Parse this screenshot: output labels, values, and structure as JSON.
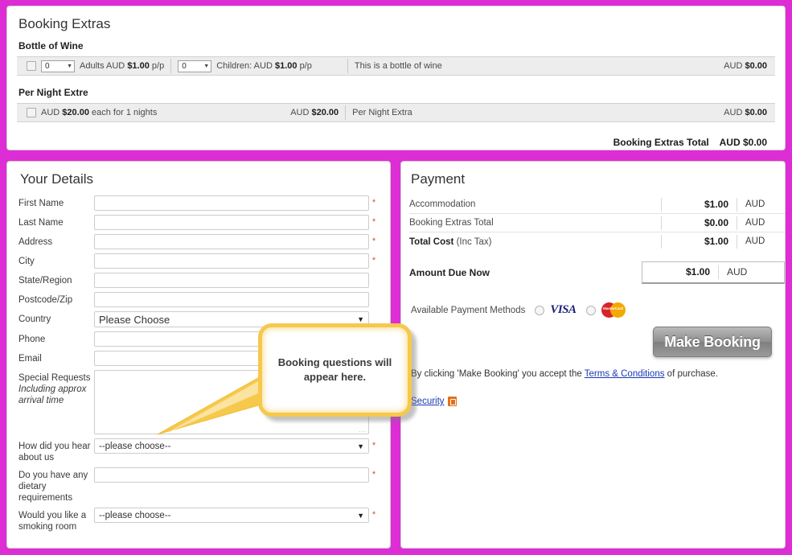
{
  "extras": {
    "title": "Booking Extras",
    "groups": [
      {
        "name": "Bottle of Wine",
        "adults_qty": "0",
        "adults_text_pre": "Adults AUD",
        "adults_price": "$1.00",
        "adults_text_post": "p/p",
        "children_qty": "0",
        "children_text_pre": "Children: AUD",
        "children_price": "$1.00",
        "children_text_post": "p/p",
        "description": "This is a bottle of wine",
        "line_amount_cur": "AUD",
        "line_amount": "$0.00"
      },
      {
        "name": "Per Night Extre",
        "rate_pre": "AUD",
        "rate_price": "$20.00",
        "rate_post": "each for 1 nights",
        "subtotal_cur": "AUD",
        "subtotal": "$20.00",
        "description": "Per Night Extra",
        "line_amount_cur": "AUD",
        "line_amount": "$0.00"
      }
    ],
    "total_label": "Booking Extras Total",
    "total_cur": "AUD",
    "total_value": "$0.00"
  },
  "details": {
    "title": "Your Details",
    "required_mark": "*",
    "fields": [
      {
        "label": "First Name",
        "type": "text",
        "value": "",
        "required": true
      },
      {
        "label": "Last Name",
        "type": "text",
        "value": "",
        "required": true
      },
      {
        "label": "Address",
        "type": "text",
        "value": "",
        "required": true
      },
      {
        "label": "City",
        "type": "text",
        "value": "",
        "required": true
      },
      {
        "label": "State/Region",
        "type": "text",
        "value": "",
        "required": false
      },
      {
        "label": "Postcode/Zip",
        "type": "text",
        "value": "",
        "required": false
      },
      {
        "label": "Country",
        "type": "select",
        "value": "Please Choose",
        "required": false
      },
      {
        "label": "Phone",
        "type": "text",
        "value": "",
        "required": false
      },
      {
        "label": "Email",
        "type": "text",
        "value": "",
        "required": false
      }
    ],
    "special_requests": {
      "label": "Special Requests",
      "sublabel": "Including approx arrival time",
      "value": ""
    },
    "questions": [
      {
        "label": "How did you hear about us",
        "type": "select",
        "value": "--please choose--",
        "required": true
      },
      {
        "label": "Do you have any dietary requirements",
        "type": "text",
        "value": "",
        "required": true
      },
      {
        "label": "Would you like a smoking room",
        "type": "select",
        "value": "--please choose--",
        "required": true
      }
    ]
  },
  "payment": {
    "title": "Payment",
    "rows": [
      {
        "label": "Accommodation",
        "label_bold": "",
        "label_rest": "",
        "amount": "$1.00",
        "currency": "AUD",
        "bold": false
      },
      {
        "label": "Booking Extras Total",
        "label_bold": "",
        "label_rest": "",
        "amount": "$0.00",
        "currency": "AUD",
        "bold": false
      },
      {
        "label": "",
        "label_bold": "Total Cost",
        "label_rest": " (Inc Tax)",
        "amount": "$1.00",
        "currency": "AUD",
        "bold": true
      }
    ],
    "due_label": "Amount Due Now",
    "due_amount": "$1.00",
    "due_currency": "AUD",
    "methods_label": "Available Payment Methods",
    "visa_label": "VISA",
    "mastercard_label": "MasterCard",
    "make_booking_label": "Make Booking",
    "terms_pre": "By clicking 'Make Booking' you accept the ",
    "terms_link": "Terms & Conditions",
    "terms_post": " of purchase.",
    "security_link": "Security"
  },
  "callout": {
    "text": "Booking questions will appear here."
  },
  "colors": {
    "page_background": "#DD2DD5",
    "panel_background": "#FFFFFF",
    "row_background": "#EDEDED",
    "required_asterisk": "#D1532A",
    "link": "#1A38B5",
    "callout_border": "#F6C84C",
    "visa_blue": "#1A1F71",
    "mastercard_red": "#D8232A",
    "mastercard_yellow": "#F2A900",
    "lock_orange": "#E2711D"
  }
}
